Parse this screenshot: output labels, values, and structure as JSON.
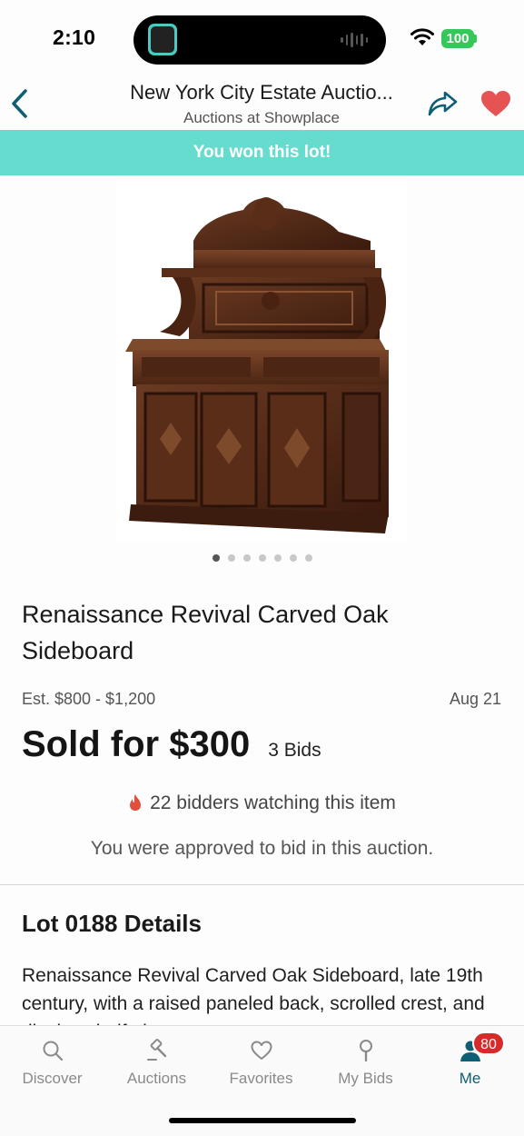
{
  "status_bar": {
    "time": "2:10",
    "battery": "100"
  },
  "nav": {
    "title": "New York City Estate Auctio...",
    "subtitle": "Auctions at Showplace"
  },
  "banner": {
    "text": "You won this lot!"
  },
  "carousel": {
    "total": 7,
    "active_index": 0
  },
  "lot": {
    "title": "Renaissance Revival Carved Oak Sideboard",
    "estimate": "Est. $800 - $1,200",
    "date": "Aug 21",
    "sold_text": "Sold for $300",
    "bids": "3 Bids",
    "watchers": "22 bidders watching this item",
    "approved": "You were approved to bid in this auction."
  },
  "details": {
    "heading": "Lot 0188 Details",
    "body": "Renaissance Revival Carved Oak Sideboard, late 19th century, with a raised paneled back, scrolled crest, and display shelf, the"
  },
  "tabs": [
    {
      "label": "Discover",
      "icon": "search-icon"
    },
    {
      "label": "Auctions",
      "icon": "gavel-icon"
    },
    {
      "label": "Favorites",
      "icon": "heart-outline-icon"
    },
    {
      "label": "My Bids",
      "icon": "paddle-icon"
    },
    {
      "label": "Me",
      "icon": "person-icon",
      "badge": "80"
    }
  ],
  "colors": {
    "accent": "#0e5e74",
    "banner": "#66dccf",
    "heart": "#e55353",
    "badge": "#d72a2a"
  }
}
